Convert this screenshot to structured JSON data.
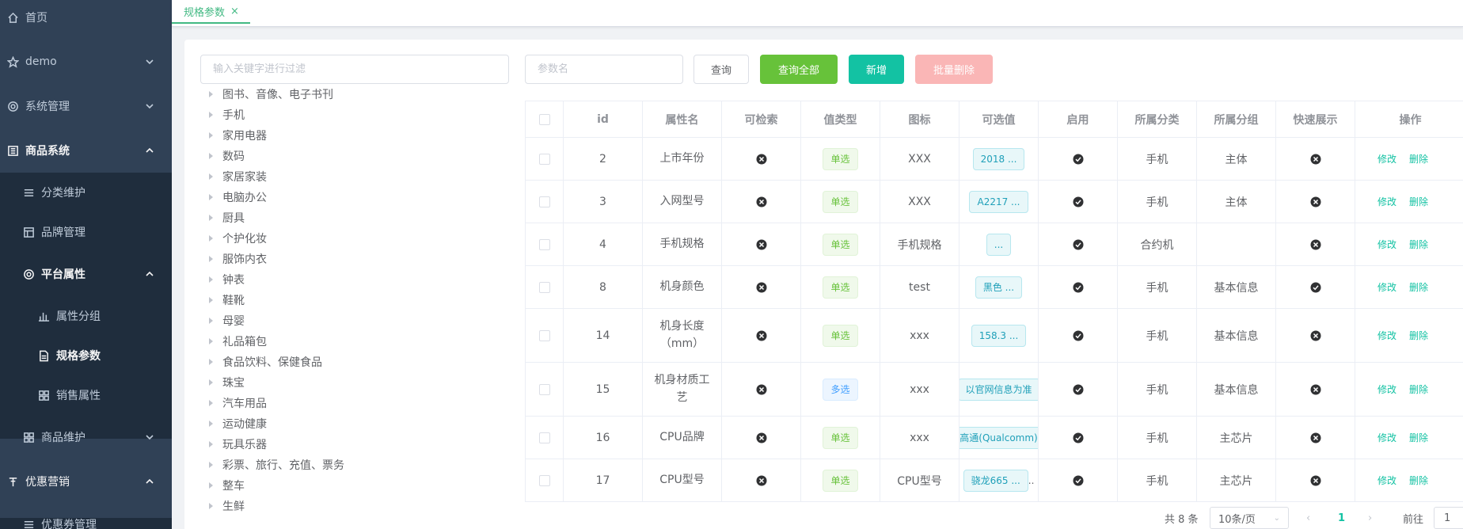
{
  "sidebar": {
    "items": [
      {
        "label": "首页",
        "icon": "home-icon"
      },
      {
        "label": "demo",
        "icon": "star-icon"
      },
      {
        "label": "系统管理",
        "icon": "gear-icon"
      },
      {
        "label": "商品系统",
        "icon": "grid-icon"
      },
      {
        "label": "分类维护",
        "icon": "list-icon"
      },
      {
        "label": "品牌管理",
        "icon": "table-icon"
      },
      {
        "label": "平台属性",
        "icon": "gear-icon"
      },
      {
        "label": "属性分组",
        "icon": "bar-chart-icon"
      },
      {
        "label": "规格参数",
        "icon": "document-icon"
      },
      {
        "label": "销售属性",
        "icon": "apps-icon"
      },
      {
        "label": "商品维护",
        "icon": "apps-icon"
      },
      {
        "label": "优惠营销",
        "icon": "pin-icon"
      },
      {
        "label": "优惠券管理",
        "icon": "list-icon"
      }
    ]
  },
  "tabs": [
    {
      "label": "规格参数",
      "close": "×"
    }
  ],
  "filter": {
    "placeholder": "输入关键字进行过滤"
  },
  "tree": [
    "图书、音像、电子书刊",
    "手机",
    "家用电器",
    "数码",
    "家居家装",
    "电脑办公",
    "厨具",
    "个护化妆",
    "服饰内衣",
    "钟表",
    "鞋靴",
    "母婴",
    "礼品箱包",
    "食品饮料、保健食品",
    "珠宝",
    "汽车用品",
    "运动健康",
    "玩具乐器",
    "彩票、旅行、充值、票务",
    "整车",
    "生鲜"
  ],
  "toolbar": {
    "param_placeholder": "参数名",
    "query": "查询",
    "query_all": "查询全部",
    "add": "新增",
    "batch_delete": "批量删除"
  },
  "table": {
    "columns": [
      "id",
      "属性名",
      "可检索",
      "值类型",
      "图标",
      "可选值",
      "启用",
      "所属分类",
      "所属分组",
      "快速展示",
      "操作"
    ],
    "rows": [
      {
        "id": "2",
        "name": "上市年份",
        "search": false,
        "type": "单选",
        "icon": "XXX",
        "values": "2018 ...",
        "enable": true,
        "catalog": "手机",
        "group": "主体",
        "show": false
      },
      {
        "id": "3",
        "name": "入网型号",
        "search": false,
        "type": "单选",
        "icon": "XXX",
        "values": "A2217 ...",
        "enable": true,
        "catalog": "手机",
        "group": "主体",
        "show": false
      },
      {
        "id": "4",
        "name": "手机规格",
        "search": false,
        "type": "单选",
        "icon": "手机规格",
        "values": "...",
        "enable": true,
        "catalog": "合约机",
        "group": "",
        "show": false
      },
      {
        "id": "8",
        "name": "机身颜色",
        "search": false,
        "type": "单选",
        "icon": "test",
        "values": "黑色 ...",
        "enable": true,
        "catalog": "手机",
        "group": "基本信息",
        "show": true
      },
      {
        "id": "14",
        "name": "机身长度（mm）",
        "search": false,
        "type": "单选",
        "icon": "xxx",
        "values": "158.3 ...",
        "enable": true,
        "catalog": "手机",
        "group": "基本信息",
        "show": false
      },
      {
        "id": "15",
        "name": "机身材质工艺",
        "search": false,
        "type": "多选",
        "icon": "xxx",
        "values": "以官网信息为准",
        "enable": true,
        "catalog": "手机",
        "group": "基本信息",
        "show": false
      },
      {
        "id": "16",
        "name": "CPU品牌",
        "search": false,
        "type": "单选",
        "icon": "xxx",
        "values": "高通(Qualcomm)",
        "enable": true,
        "catalog": "手机",
        "group": "主芯片",
        "show": false
      },
      {
        "id": "17",
        "name": "CPU型号",
        "search": false,
        "type": "单选",
        "icon": "CPU型号",
        "values": "骁龙665 ...",
        "values_extra": "..",
        "enable": true,
        "catalog": "手机",
        "group": "主芯片",
        "show": false
      }
    ],
    "edit": "修改",
    "delete": "删除"
  },
  "pager": {
    "total": "共 8 条",
    "size": "10条/页",
    "prev": "‹",
    "page": "1",
    "next": "›",
    "goto": "前往",
    "jump": "1"
  }
}
